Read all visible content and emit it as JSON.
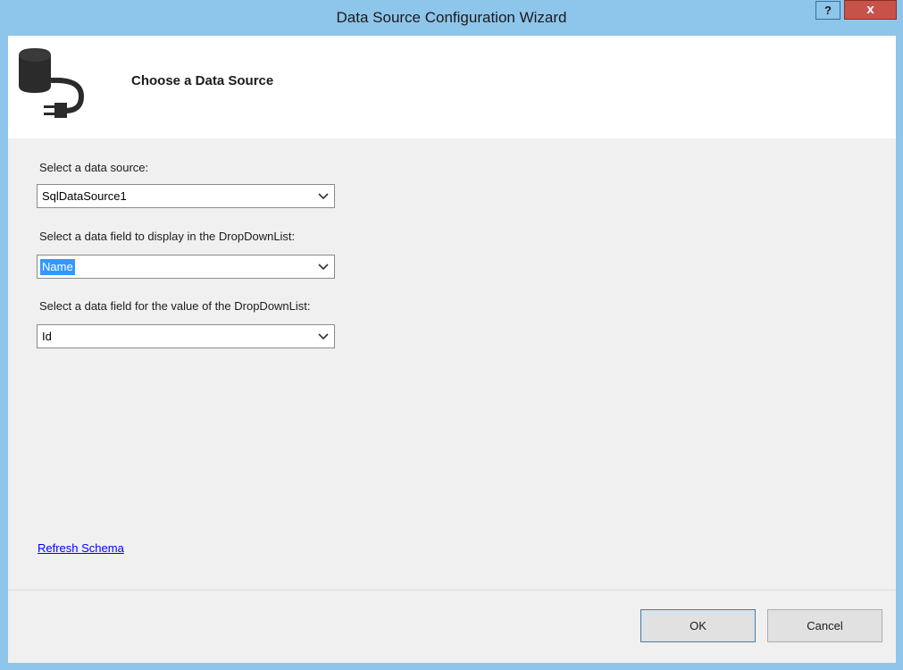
{
  "window": {
    "title": "Data Source Configuration Wizard",
    "help_label": "?",
    "close_label": "x"
  },
  "header": {
    "icon": "database-plug-icon",
    "title": "Choose a Data Source"
  },
  "form": {
    "data_source": {
      "label": "Select a data source:",
      "value": "SqlDataSource1"
    },
    "display_field": {
      "label": "Select a data field to display in the DropDownList:",
      "value": "Name"
    },
    "value_field": {
      "label": "Select a data field for the value of the DropDownList:",
      "value": "Id"
    },
    "refresh_link": "Refresh Schema"
  },
  "buttons": {
    "ok": "OK",
    "cancel": "Cancel"
  },
  "colors": {
    "titlebar": "#8ec5ea",
    "close": "#c6524a",
    "selection": "#3399ff",
    "link": "#0000ff"
  }
}
